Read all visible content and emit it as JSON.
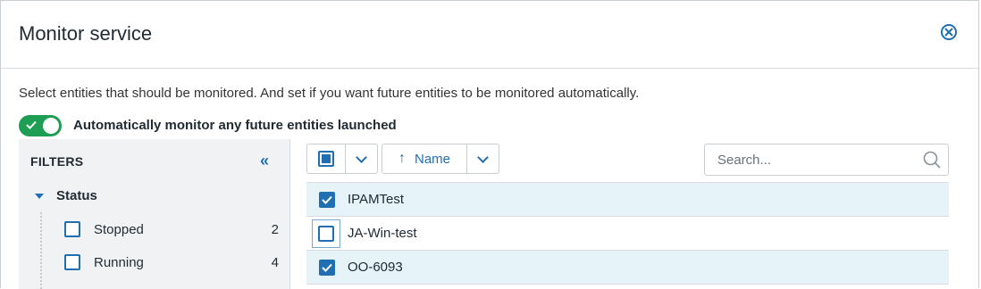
{
  "dialog": {
    "title": "Monitor service",
    "description": "Select entities that should be monitored. And set if you want future entities to be monitored automatically.",
    "auto_monitor_label": "Automatically monitor any future entities launched",
    "auto_monitor_enabled": true
  },
  "filters": {
    "title": "FILTERS",
    "collapse_icon": "double-chevron-left-icon",
    "groups": [
      {
        "label": "Status",
        "expanded": true,
        "options": [
          {
            "label": "Stopped",
            "count": "2",
            "checked": false
          },
          {
            "label": "Running",
            "count": "4",
            "checked": false
          }
        ]
      }
    ]
  },
  "toolbar": {
    "sort_label": "Name",
    "sort_direction": "ascending"
  },
  "search": {
    "placeholder": "Search...",
    "value": ""
  },
  "entities": [
    {
      "name": "IPAMTest",
      "checked": true
    },
    {
      "name": "JA-Win-test",
      "checked": false
    },
    {
      "name": "OO-6093",
      "checked": true
    }
  ],
  "colors": {
    "accent": "#1f6fb2",
    "toggle_on": "#1e9e52",
    "selected_row": "#e6f4f9"
  }
}
